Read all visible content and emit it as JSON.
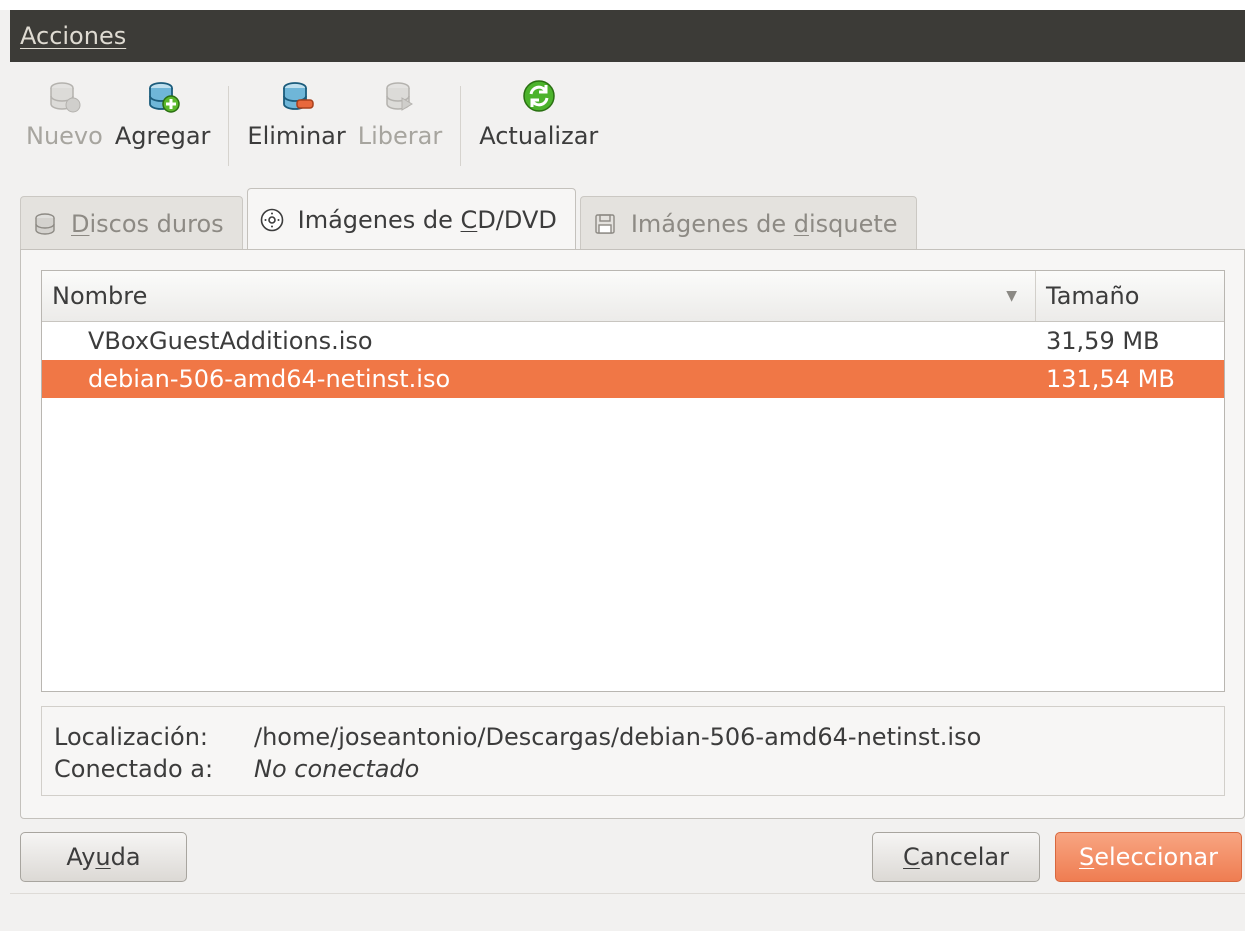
{
  "menubar": {
    "menu_label": "Acciones"
  },
  "toolbar": {
    "buttons": [
      {
        "label": "Nuevo",
        "icon": "disk-new-icon",
        "enabled": false
      },
      {
        "label": "Agregar",
        "icon": "disk-add-icon",
        "enabled": true
      },
      {
        "label": "Eliminar",
        "icon": "disk-remove-icon",
        "enabled": true
      },
      {
        "label": "Liberar",
        "icon": "disk-release-icon",
        "enabled": false
      },
      {
        "label": "Actualizar",
        "icon": "refresh-icon",
        "enabled": true
      }
    ]
  },
  "tabs": [
    {
      "pre": "",
      "u": "D",
      "post": "iscos duros",
      "icon": "hard-disk-icon",
      "active": false
    },
    {
      "pre": "Imágenes de ",
      "u": "C",
      "post": "D/DVD",
      "icon": "cd-dvd-icon",
      "active": true
    },
    {
      "pre": "Imágenes de ",
      "u": "d",
      "post": "isquete",
      "icon": "floppy-icon",
      "active": false
    }
  ],
  "list": {
    "columns": {
      "name": "Nombre",
      "size": "Tamaño"
    },
    "rows": [
      {
        "name": "VBoxGuestAdditions.iso",
        "size": "31,59 MB",
        "selected": false
      },
      {
        "name": "debian-506-amd64-netinst.iso",
        "size": "131,54 MB",
        "selected": true
      }
    ]
  },
  "details": {
    "location_label": "Localización:",
    "location_value": "/home/joseantonio/Descargas/debian-506-amd64-netinst.iso",
    "connected_label": "Conectado a:",
    "connected_value": "No conectado"
  },
  "buttons": {
    "help": {
      "pre": "Ay",
      "u": "u",
      "post": "da"
    },
    "cancel": {
      "pre": "",
      "u": "C",
      "post": "ancelar"
    },
    "select": {
      "pre": "",
      "u": "S",
      "post": "eleccionar"
    }
  },
  "colors": {
    "accent": "#f07746",
    "menubar": "#3c3b37",
    "background": "#f2f1f0"
  }
}
